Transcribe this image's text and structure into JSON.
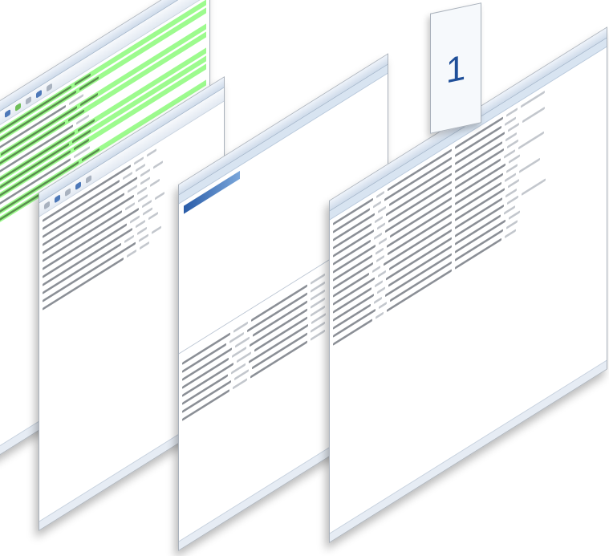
{
  "badge": {
    "value": "1"
  }
}
